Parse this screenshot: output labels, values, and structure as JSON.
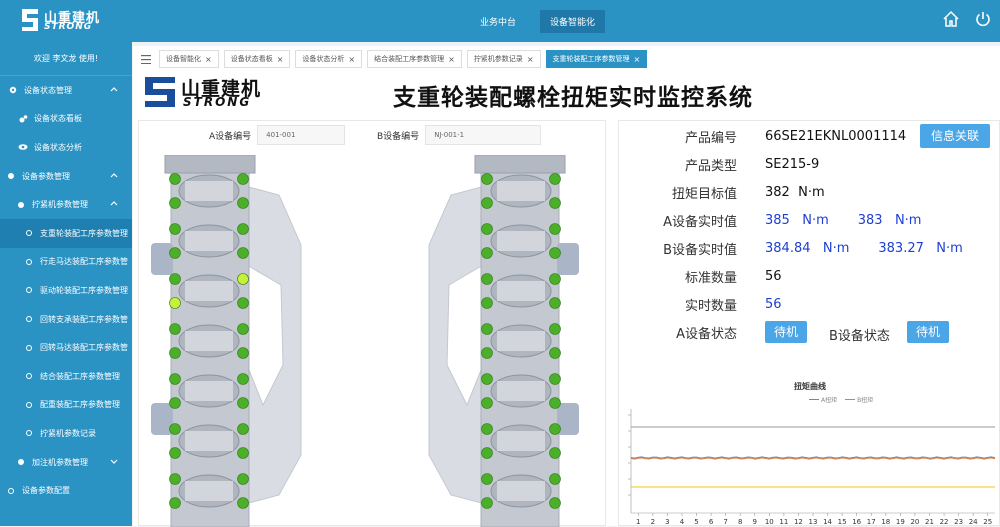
{
  "brand": {
    "cn": "山重建机",
    "en": "STRONG"
  },
  "top_nav": {
    "items": [
      {
        "label": "业务中台",
        "active": false
      },
      {
        "label": "设备智能化",
        "active": true
      }
    ],
    "icons": [
      "home-icon",
      "power-icon"
    ]
  },
  "sidebar": {
    "welcome": "欢迎 李文龙 使用!",
    "items": [
      {
        "label": "设备状态管理",
        "icon": "gear-icon"
      },
      {
        "label": "设备状态看板",
        "icon": "settings-icon"
      },
      {
        "label": "设备状态分析",
        "icon": "eye-icon"
      },
      {
        "label": "设备参数管理",
        "icon": "dot-icon"
      },
      {
        "label": "拧紧机参数管理",
        "icon": "dot-icon"
      },
      {
        "label": "支重轮装配工序参数管理",
        "icon": "circle-icon"
      },
      {
        "label": "行走马达装配工序参数管",
        "icon": "circle-icon"
      },
      {
        "label": "驱动轮装配工序参数管理",
        "icon": "circle-icon"
      },
      {
        "label": "回转支承装配工序参数管",
        "icon": "circle-icon"
      },
      {
        "label": "回转马达装配工序参数管",
        "icon": "circle-icon"
      },
      {
        "label": "结合装配工序参数管理",
        "icon": "circle-icon"
      },
      {
        "label": "配重装配工序参数管理",
        "icon": "circle-icon"
      },
      {
        "label": "拧紧机参数记录",
        "icon": "circle-icon"
      },
      {
        "label": "加注机参数管理",
        "icon": "dot-icon"
      },
      {
        "label": "设备参数配置",
        "icon": "circle-icon"
      }
    ]
  },
  "tabs": [
    {
      "label": "设备智能化"
    },
    {
      "label": "设备状态看板"
    },
    {
      "label": "设备状态分析"
    },
    {
      "label": "结合装配工序参数管理"
    },
    {
      "label": "拧紧机参数记录"
    },
    {
      "label": "支重轮装配工序参数管理",
      "active": true
    }
  ],
  "page": {
    "title": "支重轮装配螺栓扭矩实时监控系统"
  },
  "devices": {
    "a_label": "A设备编号",
    "a_value": "401-001",
    "b_label": "B设备编号",
    "b_value": "NJ-001-1"
  },
  "info": {
    "product_code_label": "产品编号",
    "product_code": "66SE21EKNL0001114",
    "relate_button": "信息关联",
    "product_type_label": "产品类型",
    "product_type": "SE215-9",
    "target_label": "扭矩目标值",
    "target_value": "382",
    "unit": "N·m",
    "a_realtime_label": "A设备实时值",
    "a_realtime_1": "385",
    "a_realtime_2": "383",
    "b_realtime_label": "B设备实时值",
    "b_realtime_1": "384.84",
    "b_realtime_2": "383.27",
    "std_count_label": "标准数量",
    "std_count": "56",
    "real_count_label": "实时数量",
    "real_count": "56",
    "a_status_label": "A设备状态",
    "a_status": "待机",
    "b_status_label": "B设备状态",
    "b_status": "待机"
  },
  "chart_data": {
    "type": "line",
    "title": "扭矩曲线",
    "x": [
      1,
      2,
      3,
      4,
      5,
      6,
      7,
      8,
      9,
      10,
      11,
      12,
      13,
      14,
      15,
      16,
      17,
      18,
      19,
      20,
      21,
      22,
      23,
      24,
      25
    ],
    "series": [
      {
        "name": "A扭矩",
        "color": "#5b8bd6"
      },
      {
        "name": "B扭矩",
        "color": "#e07b39"
      }
    ],
    "legend": "top-center",
    "grid": false
  },
  "colors": {
    "primary": "#2b93c4",
    "active": "#1f7fb0",
    "bolt": "#4caf2a",
    "bolt_highlight": "#c6f03a"
  }
}
